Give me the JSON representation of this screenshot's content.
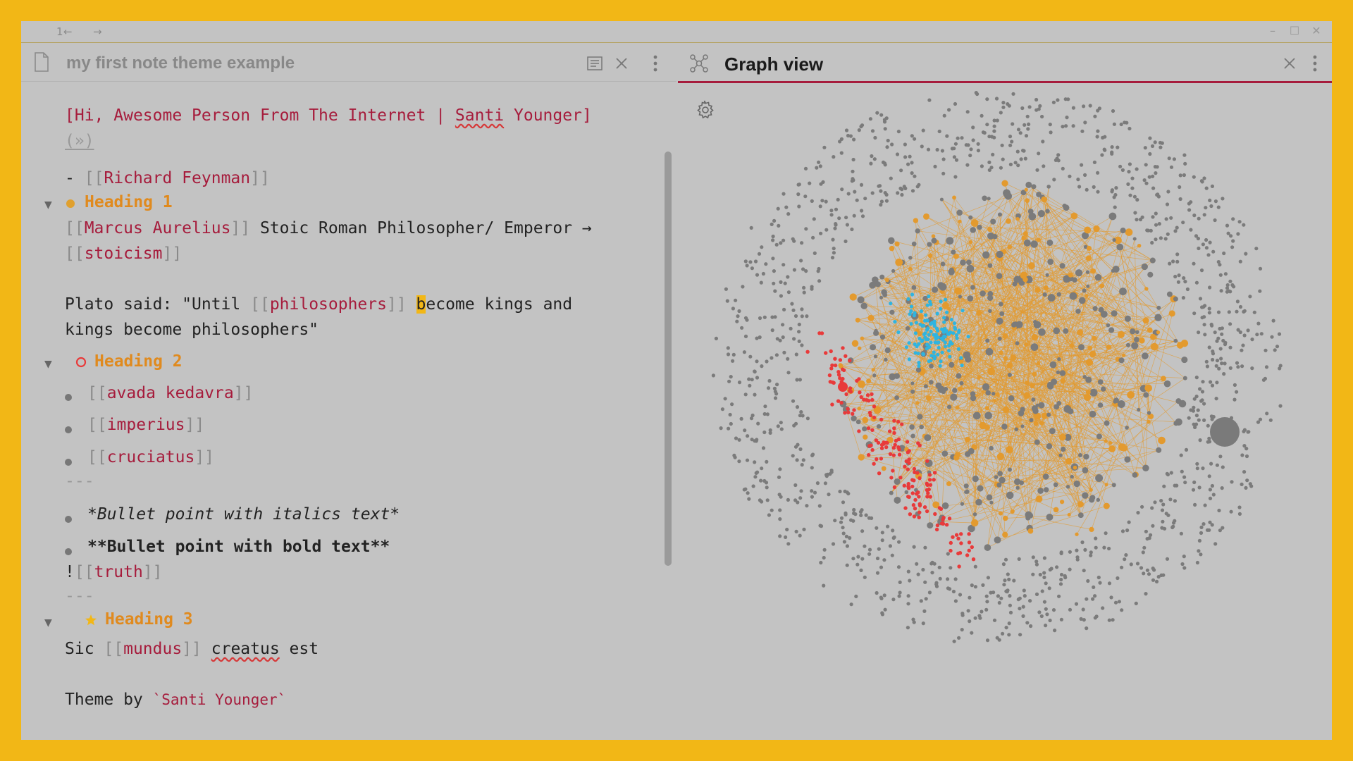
{
  "titlebar": {
    "tab_number": "1",
    "back_icon": "arrow-left-icon",
    "forward_icon": "arrow-right-icon",
    "window_controls": [
      "minimize-icon",
      "maximize-icon",
      "close-icon"
    ]
  },
  "left_pane": {
    "title": "my first note theme example",
    "header_icons": [
      "file-icon",
      "reading-view-icon",
      "close-icon",
      "more-options-icon"
    ],
    "content": {
      "line1": {
        "open": "[",
        "text": "Hi, Awesome Person From The Internet | ",
        "misspelled": "Santi",
        "rest": " Younger",
        "close": "]"
      },
      "line2": "(»)",
      "line3": {
        "prefix": "- ",
        "open": "[[",
        "link": "Richard Feynman",
        "close": "]]"
      },
      "heading1": "Heading 1",
      "line4": {
        "open": "[[",
        "link": "Marcus Aurelius",
        "close": "]]",
        "text": " Stoic Roman Philosopher/ Emperor →"
      },
      "line5": {
        "open": "[[",
        "link": "stoicism",
        "close": "]]"
      },
      "line6": {
        "before": "Plato said: \"Until ",
        "open": "[[",
        "link": "philosophers",
        "close": "]]",
        "space": " ",
        "cursor_char": "b",
        "after": "ecome kings and"
      },
      "line7": "kings become philosophers\"",
      "heading2": "Heading 2",
      "list1": [
        {
          "open": "[[",
          "link": "avada kedavra",
          "close": "]]"
        },
        {
          "open": "[[",
          "link": "imperius",
          "close": "]]"
        },
        {
          "open": "[[",
          "link": "cruciatus",
          "close": "]]"
        }
      ],
      "hr": "---",
      "list2": [
        "*Bullet point with italics text*",
        "**Bullet point with bold text**"
      ],
      "embed": {
        "prefix": "!",
        "open": "[[",
        "link": "truth",
        "close": "]]"
      },
      "heading3": "Heading 3",
      "line8": {
        "before": "Sic ",
        "open": "[[",
        "link": "mundus",
        "close": "]]",
        "space": " ",
        "misspelled": "creatus",
        "after": " est"
      },
      "line9": {
        "before": "Theme by ",
        "code": "`Santi Younger`"
      }
    }
  },
  "right_pane": {
    "title": "Graph view",
    "header_icons": [
      "graph-icon",
      "close-icon",
      "more-options-icon"
    ],
    "settings_icon": "gear-icon",
    "colors": {
      "background": "#c3c3c3",
      "node": "#7b7b7b",
      "edge": "#e39a2e",
      "group_blue": "#2fb4e0",
      "group_red": "#e83a3a",
      "accent": "#a61c3c"
    }
  },
  "colors": {
    "frame": "#f2b716",
    "link": "#a61c3c",
    "heading": "#e08a1e",
    "text": "#222222"
  }
}
